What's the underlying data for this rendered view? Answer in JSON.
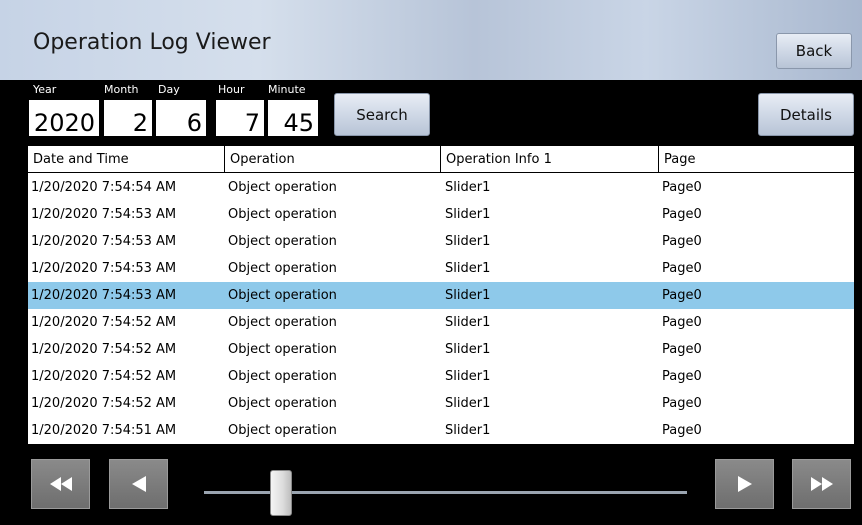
{
  "header": {
    "title": "Operation Log Viewer",
    "back_label": "Back"
  },
  "filters": {
    "year_label": "Year",
    "year": "2020",
    "month_label": "Month",
    "month": "2",
    "day_label": "Day",
    "day": "6",
    "hour_label": "Hour",
    "hour": "7",
    "minute_label": "Minute",
    "minute": "45",
    "search_label": "Search",
    "details_label": "Details"
  },
  "table": {
    "columns": [
      "Date and Time",
      "Operation",
      "Operation Info 1",
      "Page"
    ],
    "selected_row_index": 4,
    "rows": [
      [
        "1/20/2020 7:54:54 AM",
        "Object operation",
        "Slider1",
        "Page0"
      ],
      [
        "1/20/2020 7:54:53 AM",
        "Object operation",
        "Slider1",
        "Page0"
      ],
      [
        "1/20/2020 7:54:53 AM",
        "Object operation",
        "Slider1",
        "Page0"
      ],
      [
        "1/20/2020 7:54:53 AM",
        "Object operation",
        "Slider1",
        "Page0"
      ],
      [
        "1/20/2020 7:54:53 AM",
        "Object operation",
        "Slider1",
        "Page0"
      ],
      [
        "1/20/2020 7:54:52 AM",
        "Object operation",
        "Slider1",
        "Page0"
      ],
      [
        "1/20/2020 7:54:52 AM",
        "Object operation",
        "Slider1",
        "Page0"
      ],
      [
        "1/20/2020 7:54:52 AM",
        "Object operation",
        "Slider1",
        "Page0"
      ],
      [
        "1/20/2020 7:54:52 AM",
        "Object operation",
        "Slider1",
        "Page0"
      ],
      [
        "1/20/2020 7:54:51 AM",
        "Object operation",
        "Slider1",
        "Page0"
      ]
    ]
  },
  "navigation": {
    "icons": [
      "fast-rewind-icon",
      "previous-icon",
      "next-icon",
      "fast-forward-icon"
    ],
    "scroll_position": 0.14
  },
  "colors": {
    "selected_row": "#8ec9ea",
    "title_bar": "#c6d3e6"
  }
}
